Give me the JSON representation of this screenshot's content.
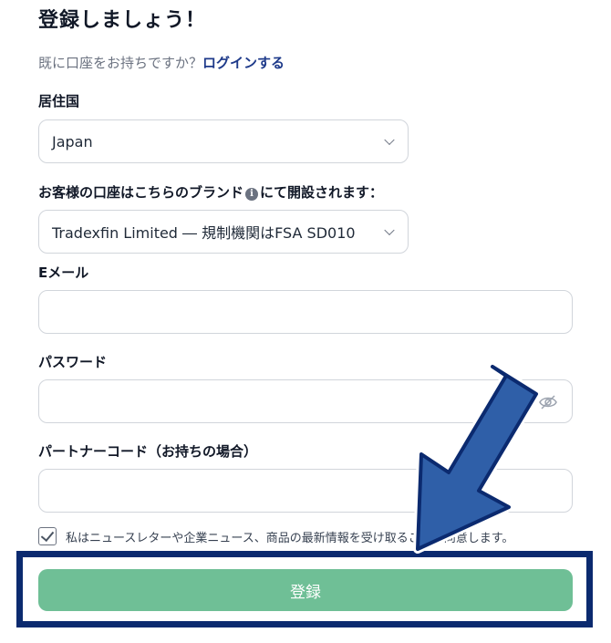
{
  "header": {
    "title": "登録しましょう！"
  },
  "login": {
    "prompt": "既に口座をお持ちですか？",
    "link": "ログインする"
  },
  "country": {
    "label": "居住国",
    "value": "Japan"
  },
  "brand": {
    "label_before": "お客様の口座はこちらのブランド",
    "label_after": "にて開設されます：",
    "info_glyph": "i",
    "value": "Tradexfin Limited ― 規制機関はFSA SD010"
  },
  "email": {
    "label": "Eメール",
    "value": "",
    "placeholder": ""
  },
  "password": {
    "label": "パスワード",
    "value": "",
    "placeholder": ""
  },
  "partner_code": {
    "label": "パートナーコード（お持ちの場合）",
    "value": "",
    "placeholder": ""
  },
  "newsletter": {
    "label": "私はニュースレターや企業ニュース、商品の最新情報を受け取ることに同意します。",
    "checked": true
  },
  "submit": {
    "label": "登録"
  },
  "colors": {
    "submit_bg": "#6fbf96",
    "highlight_border": "#0b2a6f",
    "arrow_fill": "#2f5fa8",
    "link": "#1e3a8a"
  }
}
